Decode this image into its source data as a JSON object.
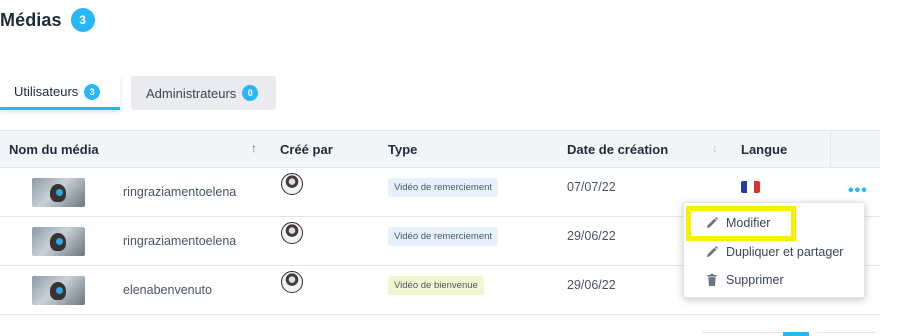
{
  "header": {
    "title": "Médias",
    "count": "3"
  },
  "tabs": [
    {
      "label": "Utilisateurs",
      "count": "3",
      "active": true
    },
    {
      "label": "Administrateurs",
      "count": "0",
      "active": false
    }
  ],
  "table": {
    "columns": {
      "name": "Nom du média",
      "creator": "Créé par",
      "type": "Type",
      "date": "Date de création",
      "language": "Langue"
    },
    "sort_icons": {
      "name": "↑",
      "date": "↓"
    },
    "rows": [
      {
        "name": "ringraziamentoelena",
        "type": "Vidéo de remerciement",
        "type_color": "#e7f1fb",
        "date": "07/07/22",
        "language_flag": "fr",
        "actions": "•••"
      },
      {
        "name": "ringraziamentoelena",
        "type": "Vidéo de remerciement",
        "type_color": "#e7f1fb",
        "date": "29/06/22",
        "language_flag": "",
        "actions": ""
      },
      {
        "name": "elenabenvenuto",
        "type": "Vidéo de bienvenue",
        "type_color": "#eef7cf",
        "date": "29/06/22",
        "language_flag": "",
        "actions": ""
      }
    ]
  },
  "context_menu": {
    "items": [
      {
        "label": "Modifier",
        "icon": "pencil-icon"
      },
      {
        "label": "Dupliquer et partager",
        "icon": "pencil-icon"
      },
      {
        "label": "Supprimer",
        "icon": "trash-icon"
      }
    ],
    "highlighted": "Modifier"
  },
  "colors": {
    "accent": "#29b6f6",
    "highlight": "#f5f200",
    "flag_fr": [
      "#1f3ea6",
      "#ffffff",
      "#e03131"
    ]
  }
}
